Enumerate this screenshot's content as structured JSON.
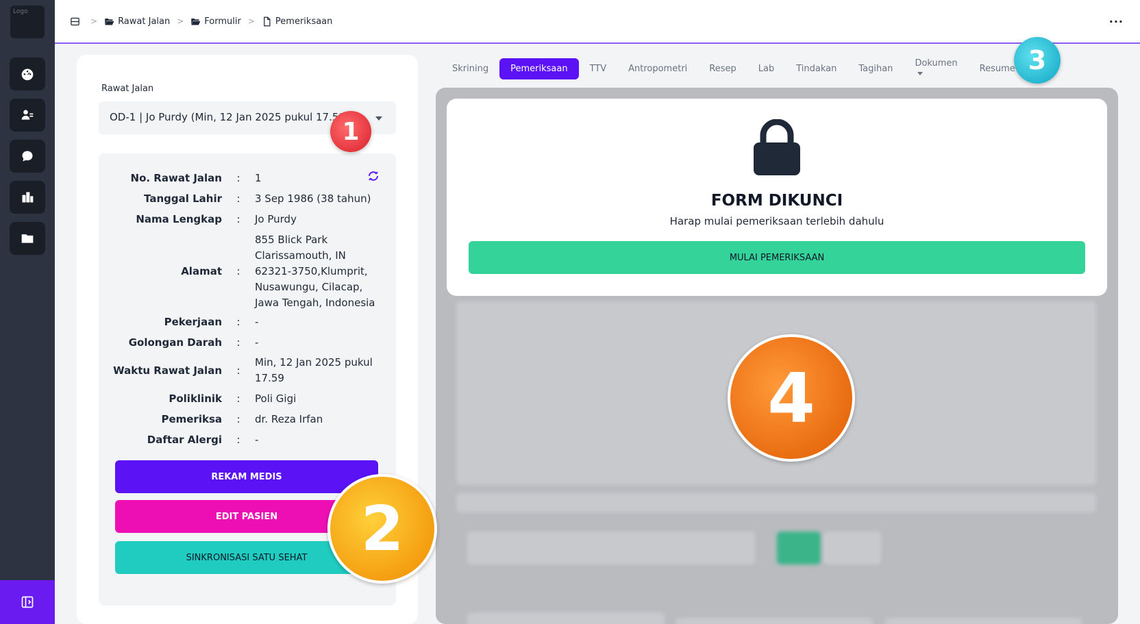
{
  "sidebar": {
    "logo_alt": "Logo",
    "icons": [
      "dashboard-icon",
      "patient-icon",
      "chat-icon",
      "building-icon",
      "folder-icon"
    ],
    "collapse_icon": "sidebar-collapse-icon"
  },
  "breadcrumb": {
    "items": [
      "Rawat Jalan",
      "Formulir",
      "Pemeriksaan"
    ]
  },
  "topbar": {
    "more": "···"
  },
  "visit": {
    "label": "Rawat Jalan",
    "selected": "OD-1 | Jo Purdy (Min, 12 Jan 2025 pukul 17.59)"
  },
  "patient": {
    "rows": [
      {
        "label": "No. Rawat Jalan",
        "sep": ":",
        "value": "1"
      },
      {
        "label": "Tanggal Lahir",
        "sep": ":",
        "value": "3 Sep 1986 (38 tahun)"
      },
      {
        "label": "Nama Lengkap",
        "sep": ":",
        "value": "Jo Purdy"
      },
      {
        "label": "Alamat",
        "sep": ":",
        "value": "855 Blick Park Clarissamouth, IN 62321-3750,Klumprit, Nusawungu, Cilacap, Jawa Tengah, Indonesia"
      },
      {
        "label": "Pekerjaan",
        "sep": ":",
        "value": "-"
      },
      {
        "label": "Golongan Darah",
        "sep": ":",
        "value": "-"
      },
      {
        "label": "Waktu Rawat Jalan",
        "sep": ":",
        "value": "Min, 12 Jan 2025 pukul 17.59"
      },
      {
        "label": "Poliklinik",
        "sep": ":",
        "value": "Poli Gigi"
      },
      {
        "label": "Pemeriksa",
        "sep": ":",
        "value": "dr. Reza Irfan"
      },
      {
        "label": "Daftar Alergi",
        "sep": ":",
        "value": "-"
      }
    ],
    "buttons": {
      "rekam_medis": "REKAM MEDIS",
      "edit_pasien": "EDIT PASIEN",
      "sinkronisasi": "SINKRONISASI SATU SEHAT"
    }
  },
  "tabs": [
    "Skrining",
    "Pemeriksaan",
    "TTV",
    "Antropometri",
    "Resep",
    "Lab",
    "Tindakan",
    "Tagihan",
    "Dokumen",
    "Resume"
  ],
  "active_tab": "Pemeriksaan",
  "lock": {
    "title": "FORM DIKUNCI",
    "subtitle": "Harap mulai pemeriksaan terlebih dahulu",
    "button": "MULAI PEMERIKSAAN"
  },
  "badges": [
    "1",
    "2",
    "3",
    "4"
  ],
  "colors": {
    "accent": "#5b12f5",
    "pink": "#ee0fb4",
    "teal": "#20ccc0",
    "green": "#34d399",
    "sidebar": "#2d3340"
  }
}
